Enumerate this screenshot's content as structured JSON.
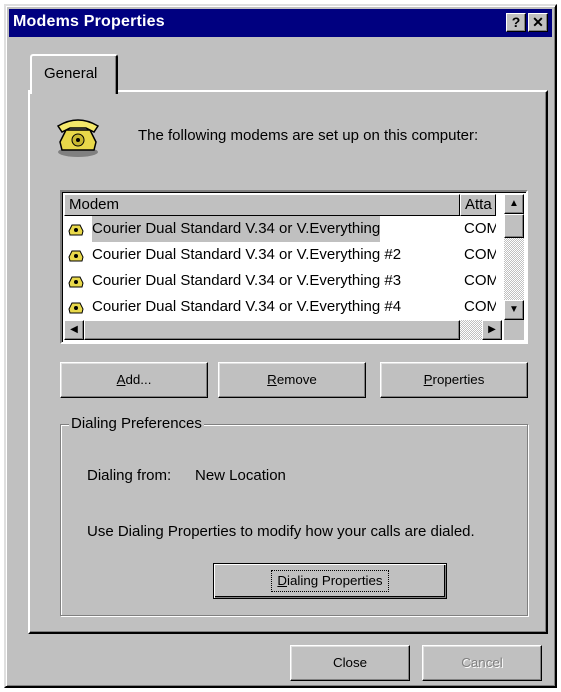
{
  "window": {
    "title": "Modems Properties",
    "help_glyph": "?",
    "close_glyph": "✕"
  },
  "tabs": [
    {
      "label": "General",
      "selected": true
    }
  ],
  "intro": {
    "icon": "telephone-icon",
    "text": "The following modems are set up on this computer:"
  },
  "modem_list": {
    "columns": [
      "Modem",
      "Attached To"
    ],
    "columns_visible": [
      "Modem",
      "Atta"
    ],
    "rows": [
      {
        "name": "Courier Dual Standard V.34 or V.Everything",
        "port": "COM",
        "selected": true
      },
      {
        "name": "Courier Dual Standard V.34 or V.Everything #2",
        "port": "COM",
        "selected": false
      },
      {
        "name": "Courier Dual Standard V.34 or V.Everything #3",
        "port": "COM",
        "selected": false
      },
      {
        "name": "Courier Dual Standard V.34 or V.Everything #4",
        "port": "COM",
        "selected": false
      }
    ]
  },
  "buttons": {
    "add_prefix": "",
    "add_accel": "A",
    "add_rest": "dd...",
    "remove_accel": "R",
    "remove_rest": "emove",
    "properties_accel": "P",
    "properties_rest": "roperties"
  },
  "dialing": {
    "group_label": "Dialing Preferences",
    "from_label": "Dialing from:",
    "from_value": "New Location",
    "hint": "Use Dialing Properties to modify how your calls are dialed.",
    "button_accel": "D",
    "button_rest": "ialing Properties"
  },
  "footer": {
    "close_label": "Close",
    "cancel_label": "Cancel",
    "cancel_enabled": false
  }
}
